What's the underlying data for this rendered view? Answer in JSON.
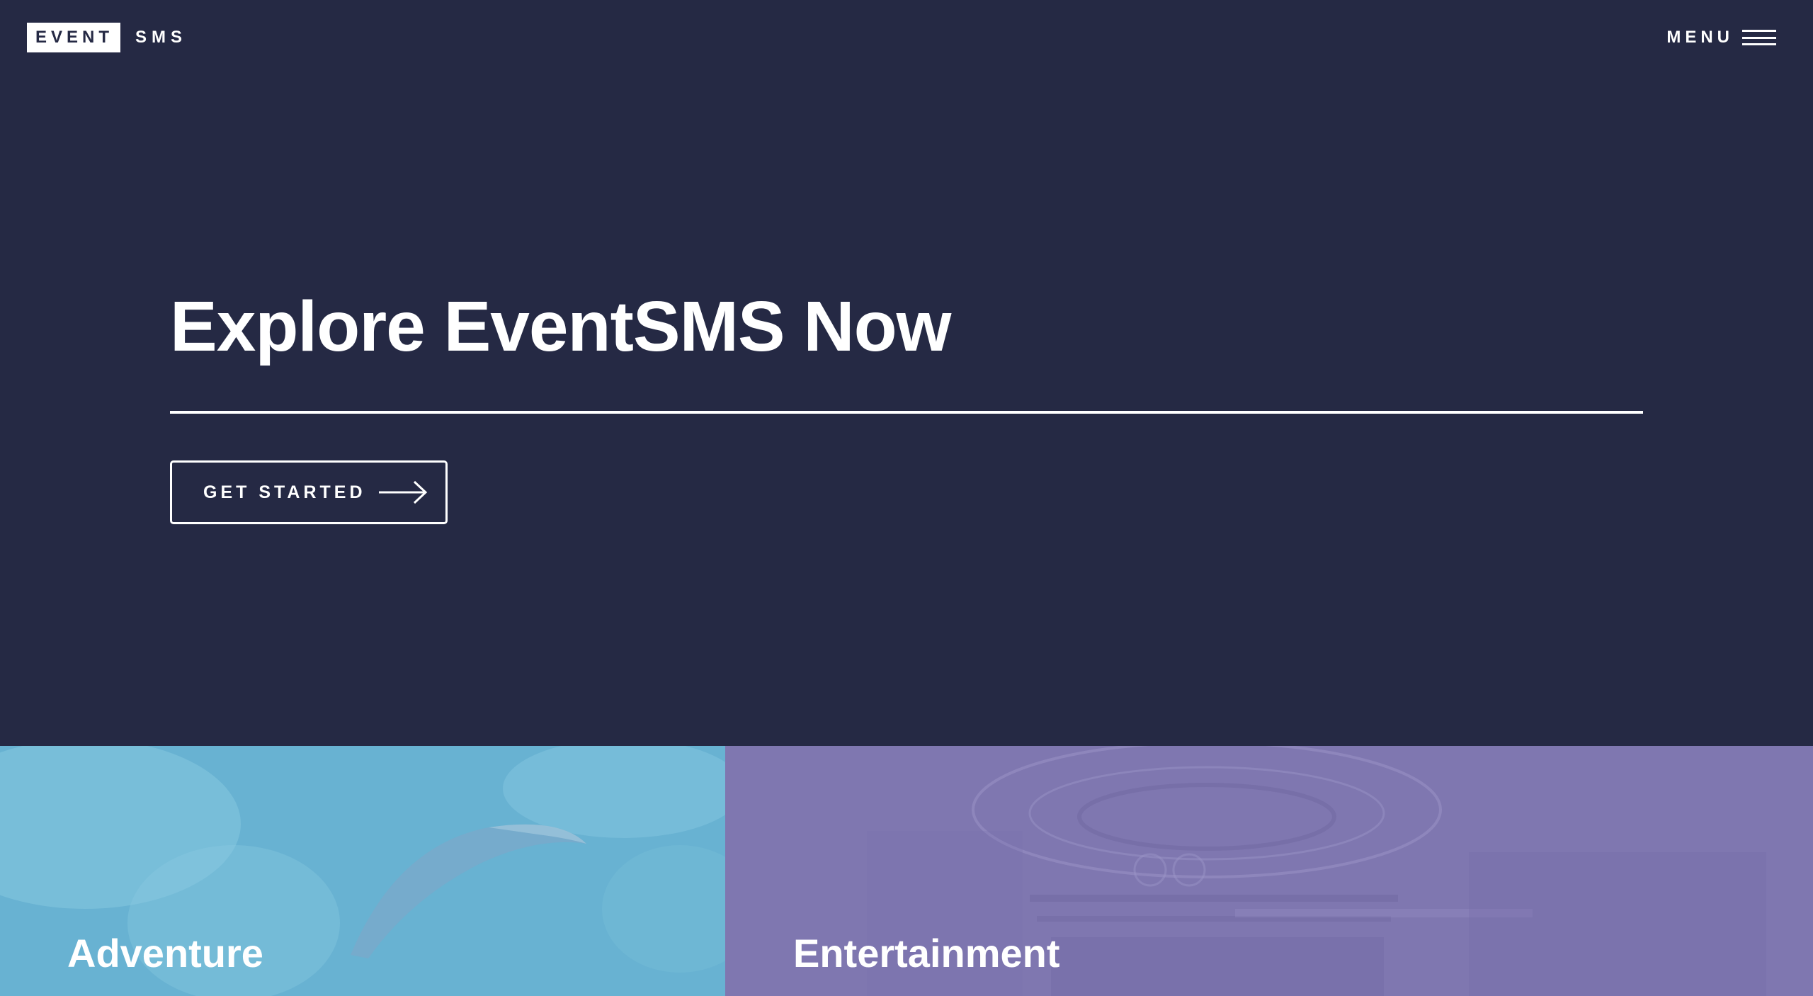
{
  "header": {
    "logo_box_text": "EVENT",
    "logo_text": "SMS",
    "menu_label": "MENU",
    "menu_icon": "hamburger-icon"
  },
  "hero": {
    "title": "Explore EventSMS Now",
    "cta_label": "GET STARTED",
    "cta_icon": "arrow-right-icon"
  },
  "categories": [
    {
      "label": "Adventure",
      "color": "#68b2d2",
      "image": "paraglider-sky-photo"
    },
    {
      "label": "Entertainment",
      "color": "#7f77b0",
      "image": "concert-stage-photo"
    }
  ],
  "colors": {
    "background": "#252944",
    "text": "#ffffff"
  }
}
